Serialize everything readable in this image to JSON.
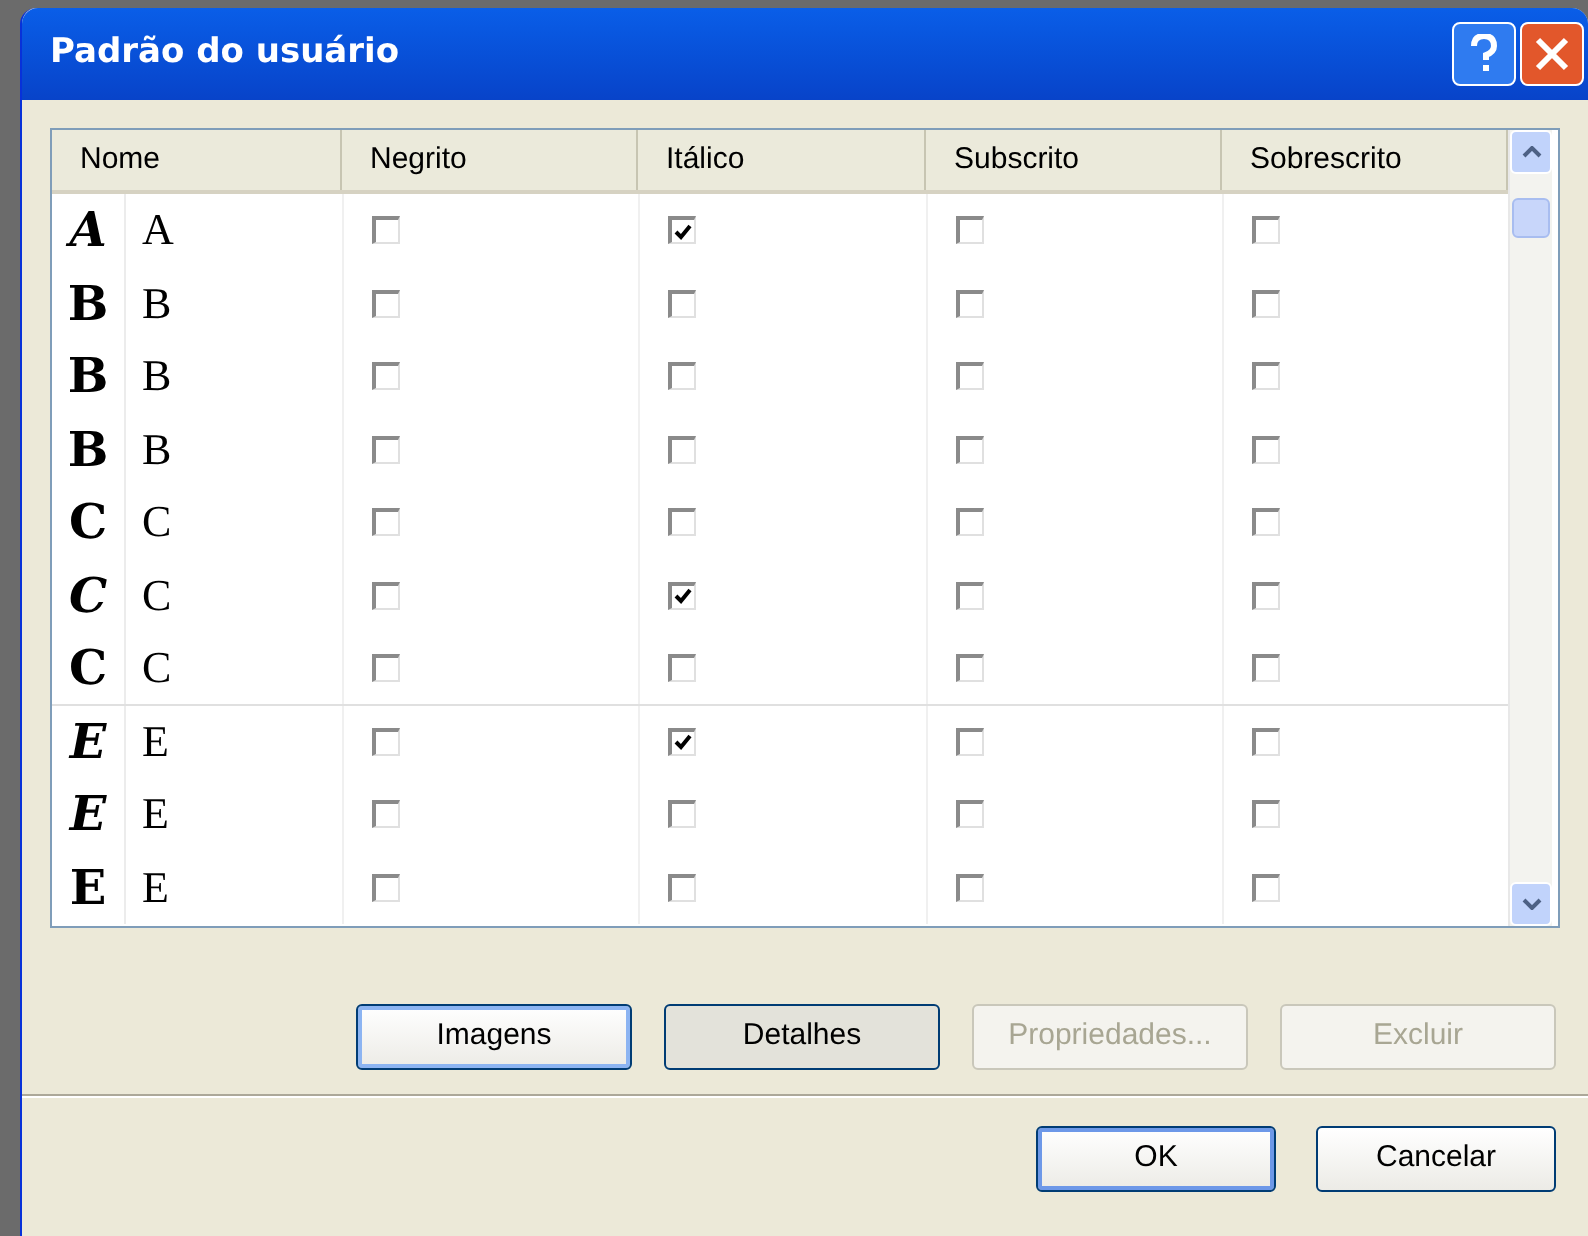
{
  "window": {
    "title": "Padrão do usuário"
  },
  "columns": [
    "Nome",
    "Negrito",
    "Itálico",
    "Subscrito",
    "Sobrescrito"
  ],
  "rows": [
    {
      "glyph": "A",
      "kind": "italic",
      "name": "A",
      "bold": false,
      "italic": true,
      "subscript": false,
      "superscript": false
    },
    {
      "glyph": "B",
      "kind": "upright",
      "name": "B",
      "bold": false,
      "italic": false,
      "subscript": false,
      "superscript": false
    },
    {
      "glyph": "B",
      "kind": "upright",
      "name": "B",
      "bold": false,
      "italic": false,
      "subscript": false,
      "superscript": false
    },
    {
      "glyph": "B",
      "kind": "upright",
      "name": "B",
      "bold": false,
      "italic": false,
      "subscript": false,
      "superscript": false
    },
    {
      "glyph": "C",
      "kind": "upright",
      "name": "C",
      "bold": false,
      "italic": false,
      "subscript": false,
      "superscript": false
    },
    {
      "glyph": "C",
      "kind": "italic",
      "name": "C",
      "bold": false,
      "italic": true,
      "subscript": false,
      "superscript": false
    },
    {
      "glyph": "C",
      "kind": "upright",
      "name": "C",
      "bold": false,
      "italic": false,
      "subscript": false,
      "superscript": false
    },
    {
      "glyph": "E",
      "kind": "italic",
      "name": "E",
      "bold": false,
      "italic": true,
      "subscript": false,
      "superscript": false
    },
    {
      "glyph": "E",
      "kind": "italic",
      "name": "E",
      "bold": false,
      "italic": false,
      "subscript": false,
      "superscript": false
    },
    {
      "glyph": "E",
      "kind": "upright",
      "name": "E",
      "bold": false,
      "italic": false,
      "subscript": false,
      "superscript": false
    }
  ],
  "view_buttons": [
    {
      "label": "Imagens",
      "selected": false,
      "disabled": false
    },
    {
      "label": "Detalhes",
      "selected": true,
      "disabled": false
    },
    {
      "label": "Propriedades...",
      "selected": false,
      "disabled": true
    },
    {
      "label": "Excluir",
      "selected": false,
      "disabled": true
    }
  ],
  "dialog_buttons": [
    {
      "label": "OK",
      "default": true
    },
    {
      "label": "Cancelar",
      "default": false
    }
  ]
}
